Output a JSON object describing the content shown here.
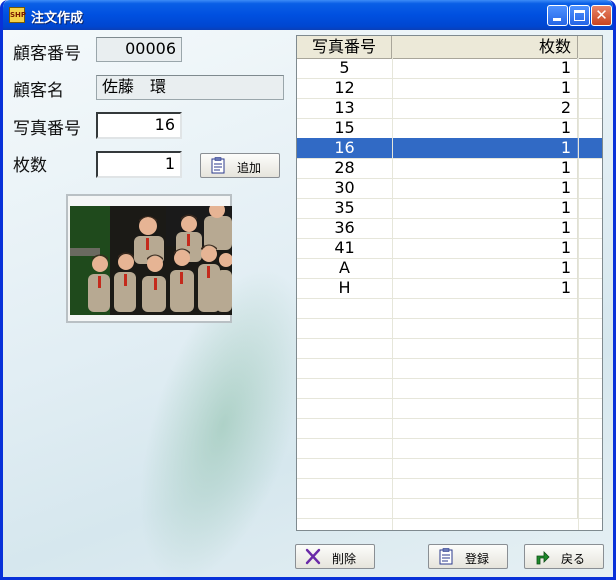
{
  "window": {
    "title": "注文作成",
    "app_icon": "app-icon"
  },
  "form": {
    "customer_no_label": "顧客番号",
    "customer_no_value": "00006",
    "customer_name_label": "顧客名",
    "customer_name_value": "佐藤　環",
    "photo_no_label": "写真番号",
    "photo_no_value": "16",
    "qty_label": "枚数",
    "qty_value": "1",
    "add_button_label": "追加"
  },
  "grid": {
    "headers": [
      "写真番号",
      "枚数"
    ],
    "rows": [
      {
        "photo": "5",
        "qty": "1"
      },
      {
        "photo": "12",
        "qty": "1"
      },
      {
        "photo": "13",
        "qty": "2"
      },
      {
        "photo": "15",
        "qty": "1"
      },
      {
        "photo": "16",
        "qty": "1",
        "selected": true
      },
      {
        "photo": "28",
        "qty": "1"
      },
      {
        "photo": "30",
        "qty": "1"
      },
      {
        "photo": "35",
        "qty": "1"
      },
      {
        "photo": "36",
        "qty": "1"
      },
      {
        "photo": "41",
        "qty": "1"
      },
      {
        "photo": "A",
        "qty": "1"
      },
      {
        "photo": "H",
        "qty": "1"
      }
    ],
    "empty_rows": 11
  },
  "footer": {
    "delete_label": "削除",
    "register_label": "登録",
    "back_label": "戻る"
  },
  "colors": {
    "selection": "#316ac5",
    "titlebar": "#0050e0"
  }
}
